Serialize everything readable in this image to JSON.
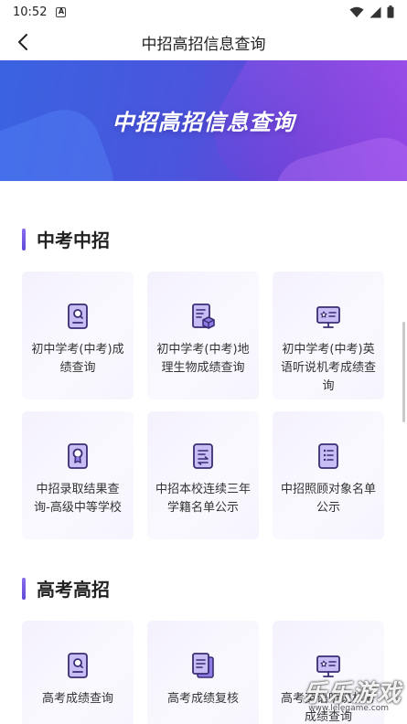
{
  "status_bar": {
    "time": "10:52",
    "notification_badge": "A"
  },
  "nav": {
    "title": "中招高招信息查询"
  },
  "banner": {
    "title": "中招高招信息查询"
  },
  "sections": [
    {
      "title": "中考中招",
      "items": [
        {
          "label": "初中学考(中考)成绩查询",
          "icon": "report-search-icon"
        },
        {
          "label": "初中学考(中考)地理生物成绩查询",
          "icon": "document-cube-icon"
        },
        {
          "label": "初中学考(中考)英语听说机考成绩查询",
          "icon": "monitor-star-icon"
        },
        {
          "label": "中招录取结果查询-高级中等学校",
          "icon": "certificate-badge-icon"
        },
        {
          "label": "中招本校连续三年学籍名单公示",
          "icon": "list-exchange-icon"
        },
        {
          "label": "中招照顾对象名单公示",
          "icon": "list-document-icon"
        }
      ]
    },
    {
      "title": "高考高招",
      "items": [
        {
          "label": "高考成绩查询",
          "icon": "report-search-icon"
        },
        {
          "label": "高考成绩复核",
          "icon": "document-stack-icon"
        },
        {
          "label": "高考英语听说机考成绩查询",
          "icon": "monitor-star-icon"
        }
      ]
    }
  ],
  "watermark": {
    "text": "乐乐游戏",
    "url": "www.lelegame.com"
  },
  "colors": {
    "accent": "#6a4ae0",
    "icon_fill": "#c8bdf5",
    "banner_start": "#3a63e0",
    "banner_end": "#8c3fe0"
  }
}
